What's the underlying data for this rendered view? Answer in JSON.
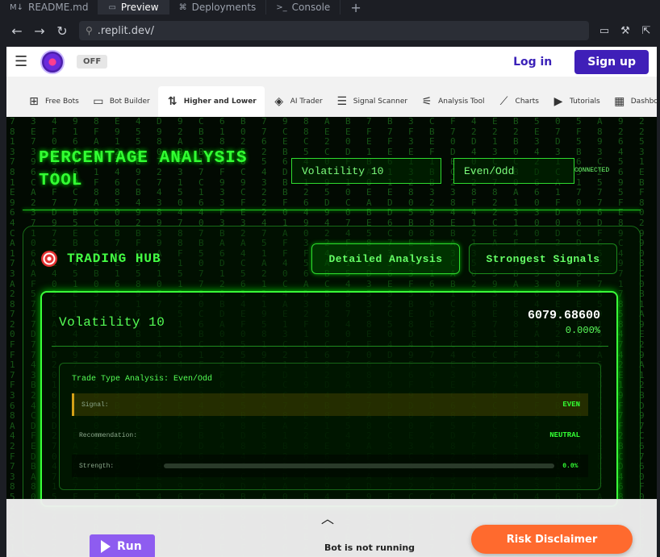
{
  "ide": {
    "tabs": [
      {
        "glyph": "M↓",
        "label": "README.md",
        "active": false
      },
      {
        "glyph": "▭",
        "label": "Preview",
        "active": true
      },
      {
        "glyph": "⌘",
        "label": "Deployments",
        "active": false
      },
      {
        "glyph": ">_",
        "label": "Console",
        "active": false
      }
    ],
    "add_glyph": "+"
  },
  "browser": {
    "url": ".replit.dev/"
  },
  "site": {
    "toggle": "OFF",
    "login": "Log in",
    "signup": "Sign up"
  },
  "nav": [
    {
      "icon": "free-bots-icon",
      "glyph": "⊞",
      "label": "Free Bots"
    },
    {
      "icon": "bot-builder-icon",
      "glyph": "▭",
      "label": "Bot Builder"
    },
    {
      "icon": "higher-lower-icon",
      "glyph": "⇅",
      "label": "Higher and Lower",
      "active": true
    },
    {
      "icon": "ai-trader-icon",
      "glyph": "◈",
      "label": "AI Trader"
    },
    {
      "icon": "signal-scanner-icon",
      "glyph": "☰",
      "label": "Signal Scanner"
    },
    {
      "icon": "analysis-tool-icon",
      "glyph": "⚟",
      "label": "Analysis Tool"
    },
    {
      "icon": "charts-icon",
      "glyph": "⟋",
      "label": "Charts"
    },
    {
      "icon": "tutorials-icon",
      "glyph": "▶",
      "label": "Tutorials"
    },
    {
      "icon": "dashboard-icon",
      "glyph": "▦",
      "label": "Dashboard"
    }
  ],
  "tool": {
    "title": "PERCENTAGE ANALYSIS TOOL",
    "market_select": "Volatility 10",
    "type_select": "Even/Odd",
    "status": "CONNECTED"
  },
  "hub": {
    "title": "TRADING HUB",
    "detailed_btn": "Detailed Analysis",
    "strongest_btn": "Strongest Signals"
  },
  "market": {
    "name": "Volatility 10",
    "price": "6079.68600",
    "change": "0.000%"
  },
  "analysis": {
    "title": "Trade Type Analysis: Even/Odd",
    "signal_label": "Signal:",
    "signal_value": "EVEN",
    "reco_label": "Recommendation:",
    "reco_value": "NEUTRAL",
    "strength_label": "Strength:",
    "strength_value": "0.0%",
    "strength_fraction": 0.0
  },
  "footer": {
    "run": "Run",
    "bot_status": "Bot is not running",
    "risk": "Risk Disclaimer"
  },
  "colors": {
    "matrix_green": "#33ff33",
    "brand_purple": "#3f1fb8",
    "risk_orange": "#ff6a2e",
    "run_purple": "#8e5cf0"
  }
}
